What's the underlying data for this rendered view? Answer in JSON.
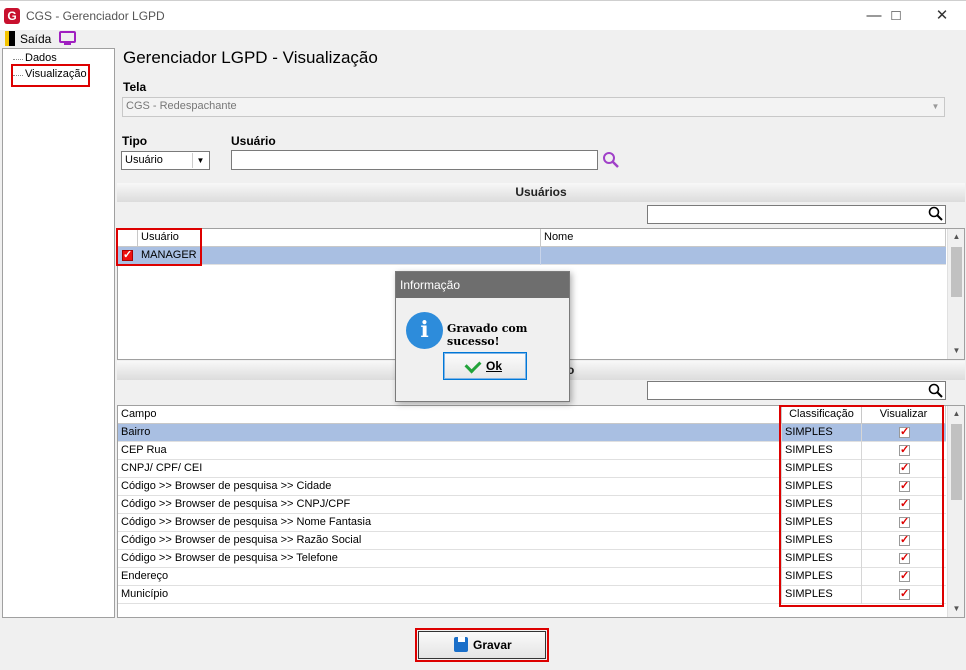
{
  "window": {
    "title": "CGS - Gerenciador LGPD",
    "logo": "G"
  },
  "menu": {
    "exit_label": "Saída"
  },
  "tree": {
    "items": [
      "Dados",
      "Visualização"
    ]
  },
  "page": {
    "title": "Gerenciador LGPD - Visualização"
  },
  "tela": {
    "label": "Tela",
    "value": "CGS - Redespachante"
  },
  "tipo": {
    "label": "Tipo",
    "value": "Usuário"
  },
  "usuario": {
    "label": "Usuário",
    "value": ""
  },
  "users_section": {
    "title": "Usuários",
    "columns": [
      "Usuário",
      "Nome"
    ],
    "rows": [
      {
        "checked": true,
        "usuario": "MANAGER",
        "nome": ""
      }
    ]
  },
  "fields_section": {
    "title": "o",
    "columns": [
      "Campo",
      "Classificação",
      "Visualizar"
    ],
    "rows": [
      {
        "campo": "Bairro",
        "classificacao": "SIMPLES",
        "visualizar": true
      },
      {
        "campo": "CEP Rua",
        "classificacao": "SIMPLES",
        "visualizar": true
      },
      {
        "campo": "CNPJ/ CPF/ CEI",
        "classificacao": "SIMPLES",
        "visualizar": true
      },
      {
        "campo": "Código >> Browser de pesquisa >> Cidade",
        "classificacao": "SIMPLES",
        "visualizar": true
      },
      {
        "campo": "Código >> Browser de pesquisa >> CNPJ/CPF",
        "classificacao": "SIMPLES",
        "visualizar": true
      },
      {
        "campo": "Código >> Browser de pesquisa >> Nome Fantasia",
        "classificacao": "SIMPLES",
        "visualizar": true
      },
      {
        "campo": "Código >> Browser de pesquisa >> Razão Social",
        "classificacao": "SIMPLES",
        "visualizar": true
      },
      {
        "campo": "Código >> Browser de pesquisa >> Telefone",
        "classificacao": "SIMPLES",
        "visualizar": true
      },
      {
        "campo": "Endereço",
        "classificacao": "SIMPLES",
        "visualizar": true
      },
      {
        "campo": "Município",
        "classificacao": "SIMPLES",
        "visualizar": true
      }
    ]
  },
  "save_button": {
    "label": "Gravar"
  },
  "dialog": {
    "title": "Informação",
    "message": "Gravado com sucesso!",
    "ok_label": "Ok"
  },
  "colors": {
    "highlight": "#dd0000",
    "selection": "#a9bfe2",
    "dialog_title": "#6e6e6e",
    "info_icon": "#2d8cdb"
  }
}
